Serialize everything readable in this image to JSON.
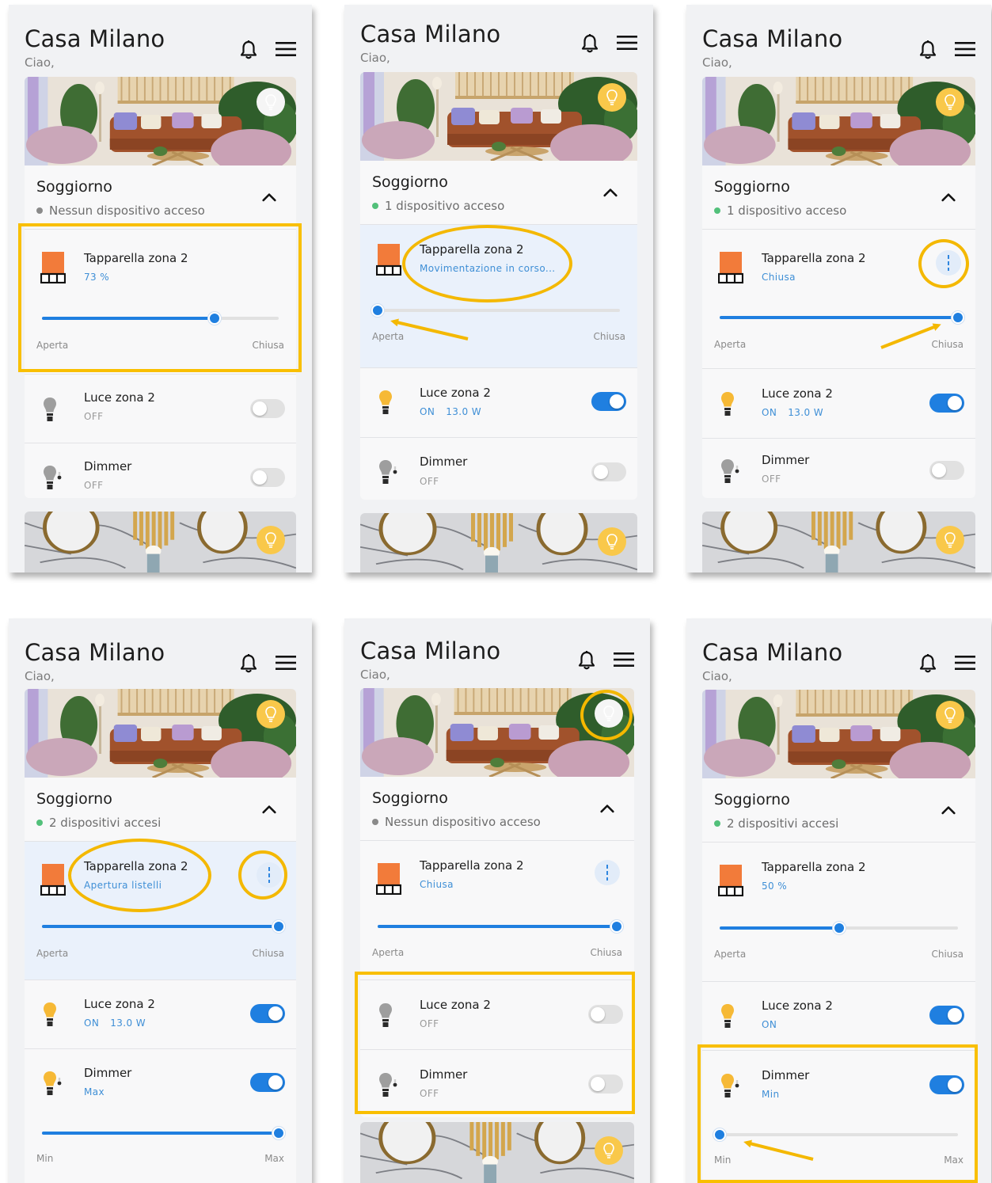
{
  "app": {
    "title": "Casa Milano",
    "greeting": "Ciao,"
  },
  "room": {
    "name": "Soggiorno"
  },
  "labels": {
    "aperta": "Aperta",
    "chiusa": "Chiusa",
    "min": "Min",
    "max": "Max",
    "shutter": "Tapparella zona 2",
    "light": "Luce zona 2",
    "dimmer": "Dimmer",
    "on": "ON",
    "off": "OFF",
    "power": "13.0 W"
  },
  "colors": {
    "accent": "#1f7fe0",
    "highlight": "#f9bf00",
    "shutter_icon": "#f27b3a",
    "status_on": "#52c07a"
  },
  "icons": {
    "notifications": "bell-icon",
    "menu": "hamburger-menu-icon",
    "collapse": "chevron-up-icon",
    "room_light": "lightbulb-icon",
    "shutter": "shutter-icon",
    "more": "more-vertical-icon"
  },
  "screens": [
    {
      "room_status": "Nessun dispositivo acceso",
      "room_light_on": false,
      "shutter_status": "73 %",
      "shutter_position": 0.73,
      "light_on": false,
      "light_status": "OFF",
      "dimmer_on": false,
      "dimmer_status": "OFF"
    },
    {
      "room_status": "1 dispositivo acceso",
      "room_light_on": true,
      "shutter_status": "Movimentazione in corso...",
      "shutter_position": 0.0,
      "light_on": true,
      "light_status": "ON",
      "light_power": "13.0 W",
      "dimmer_on": false,
      "dimmer_status": "OFF"
    },
    {
      "room_status": "1 dispositivo acceso",
      "room_light_on": true,
      "shutter_status": "Chiusa",
      "shutter_position": 1.0,
      "light_on": true,
      "light_status": "ON",
      "light_power": "13.0 W",
      "dimmer_on": false,
      "dimmer_status": "OFF"
    },
    {
      "room_status": "2 dispositivi accesi",
      "room_light_on": true,
      "shutter_status": "Apertura listelli",
      "shutter_position": 1.0,
      "light_on": true,
      "light_status": "ON",
      "light_power": "13.0 W",
      "dimmer_on": true,
      "dimmer_status": "Max",
      "dimmer_level": 1.0
    },
    {
      "room_status": "Nessun dispositivo acceso",
      "room_light_on": false,
      "shutter_status": "Chiusa",
      "shutter_position": 1.0,
      "light_on": false,
      "light_status": "OFF",
      "dimmer_on": false,
      "dimmer_status": "OFF"
    },
    {
      "room_status": "2 dispositivi accesi",
      "room_light_on": true,
      "shutter_status": "50 %",
      "shutter_position": 0.5,
      "light_on": true,
      "light_status": "ON",
      "dimmer_on": true,
      "dimmer_status": "Min",
      "dimmer_level": 0.0
    }
  ]
}
